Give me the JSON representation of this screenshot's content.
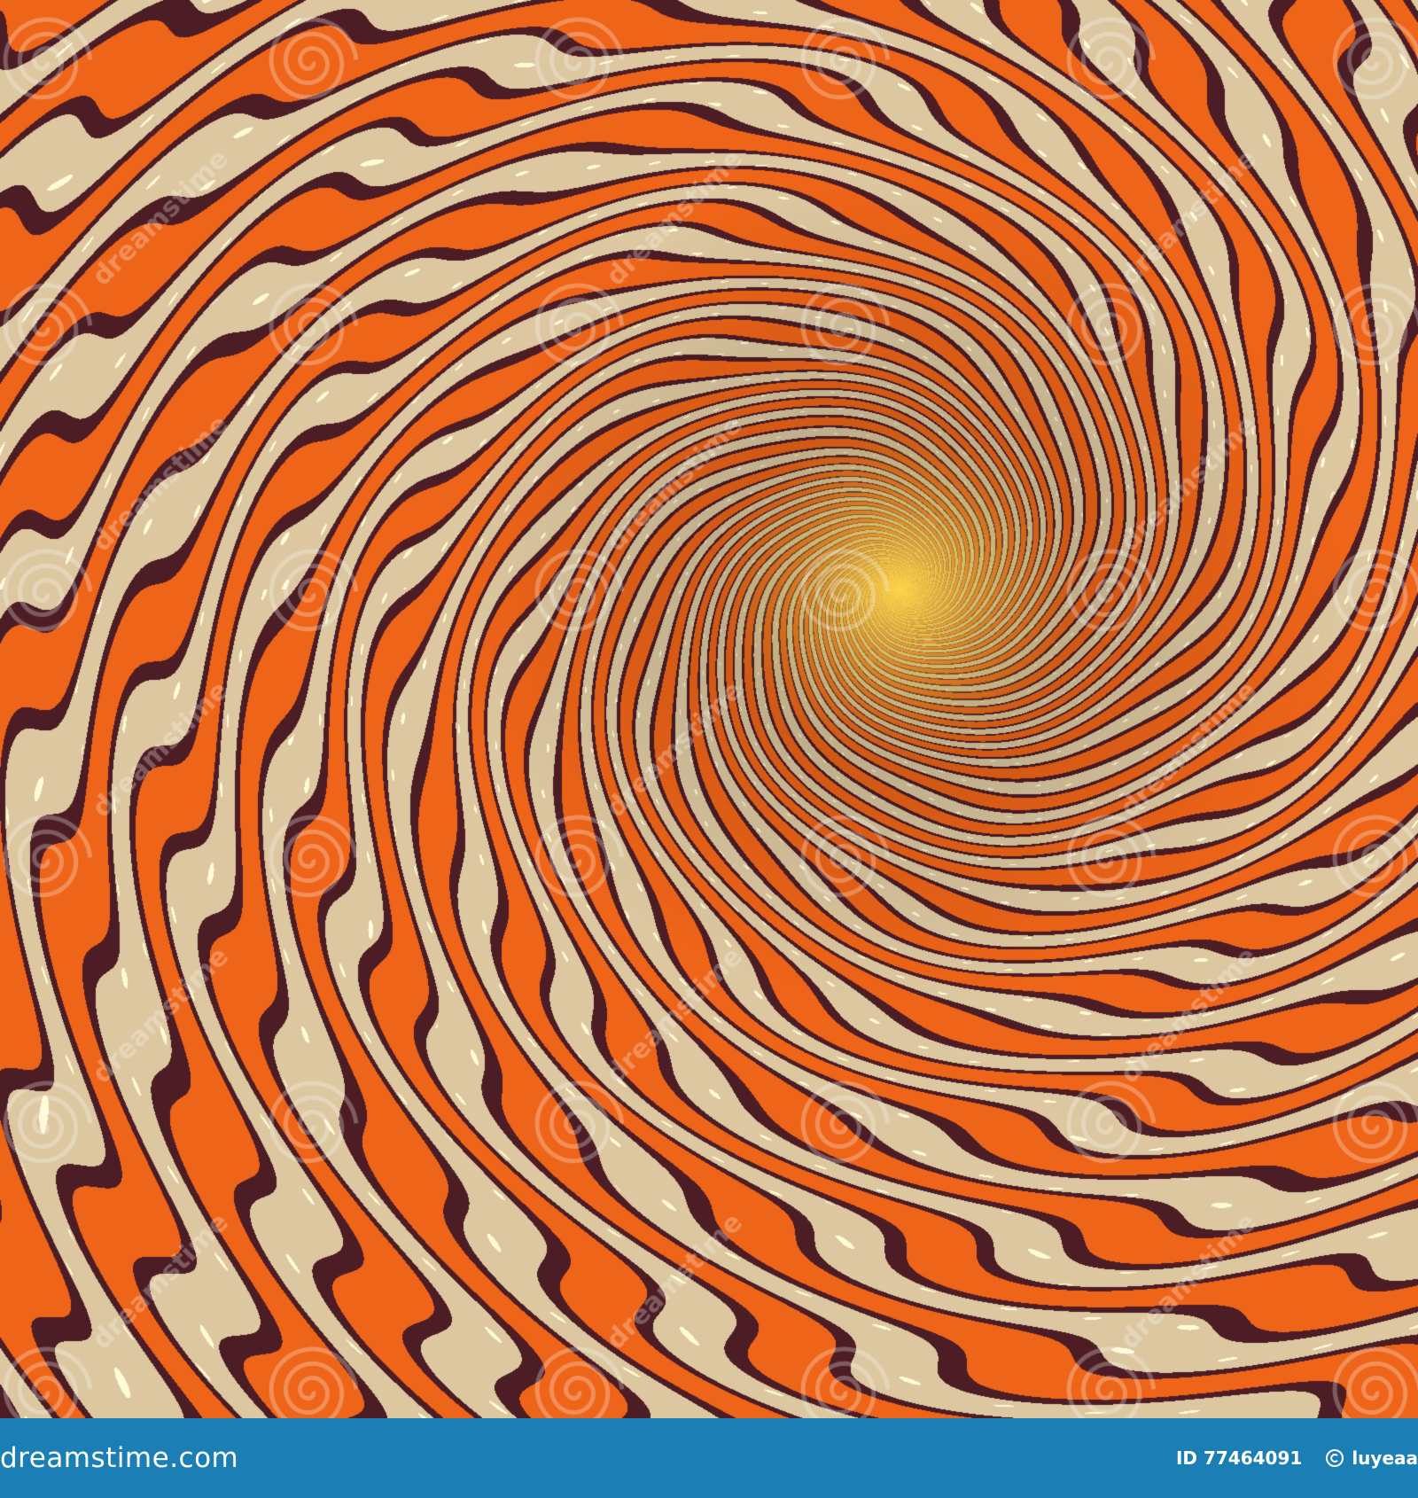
{
  "image": {
    "subject": "swirling orange, cream and dark brown striped spiral tunnel with a glowing yellow center",
    "colors": {
      "orange": "#ee6418",
      "cream": "#dcc7a0",
      "brown": "#4d1d25",
      "highlight": "#fffbd6",
      "glow": "#ffd64a",
      "footer": "#1b7fb5"
    }
  },
  "watermark": {
    "text": "dreamstime",
    "logo_icon": "spiral-logo-icon"
  },
  "footer": {
    "brand": "dreamstime.com",
    "id_label": "ID 77464091",
    "author": "luyeaa",
    "author_icon": "copyright-icon"
  }
}
